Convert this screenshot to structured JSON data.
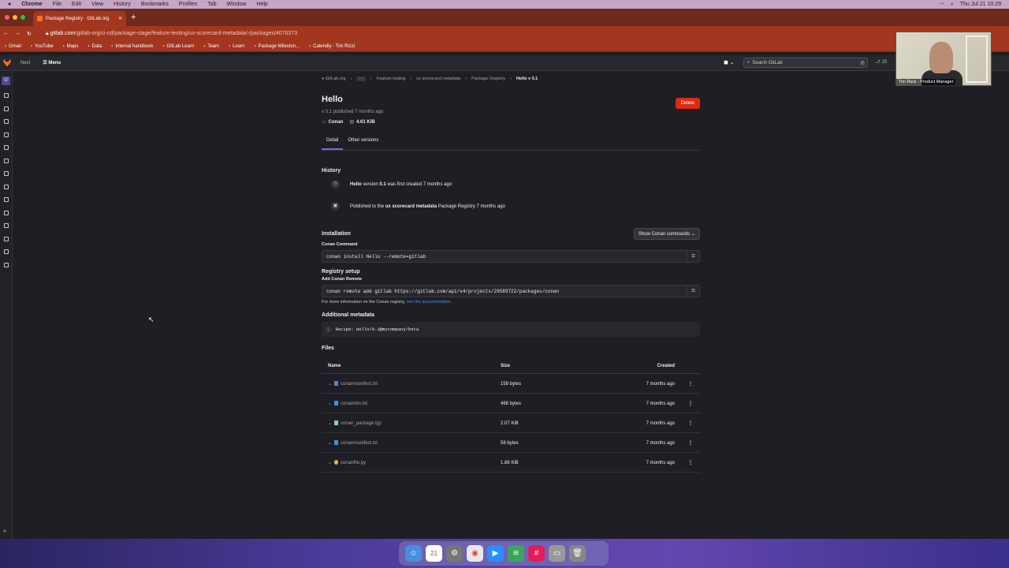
{
  "mac_menu": {
    "apple": "",
    "items": [
      "Chrome",
      "File",
      "Edit",
      "View",
      "History",
      "Bookmarks",
      "Profiles",
      "Tab",
      "Window",
      "Help"
    ],
    "datetime": "Thu Jul 21  10:29"
  },
  "browser": {
    "tab_title": "Package Registry · GitLab.org",
    "tab_close": "✕",
    "new_tab": "+",
    "url_host": "gitlab.com",
    "url_path": "/gitlab-org/ci-cd/package-stage/feature-testing/ux-scorecard-metadata/-/packages/4076373",
    "bookmarks": [
      "Gmail",
      "YouTube",
      "Maps",
      "Data",
      "Internal handbook",
      "GitLab Learn",
      "Team",
      "Learn",
      "Package Mileston...",
      "Calendly - Tim Rizzi"
    ]
  },
  "gitlab_top": {
    "next_label": "Next",
    "menu_label": "Menu",
    "search_placeholder": "Search GitLab",
    "search_shortcut": "/",
    "mr_count": "20"
  },
  "sidebar": {
    "avatar_letter": "U",
    "collapse": "»"
  },
  "breadcrumbs": [
    "GitLab.org",
    "···",
    "Feature testing",
    "ux scorecard metadata",
    "Package Registry",
    "Hello v 0.1"
  ],
  "package": {
    "title": "Hello",
    "delete_label": "Delete",
    "published": "v 0.1 published  7 months ago",
    "type": "Conan",
    "size": "4.61 KiB"
  },
  "tabs": [
    "Detail",
    "Other versions"
  ],
  "history": {
    "heading": "History",
    "row1_name": "Hello",
    "row1_mid": " version ",
    "row1_version": "0.1",
    "row1_end": " was first created 7 months ago",
    "row2_start": "Published to the ",
    "row2_project": "ux scorecard metadata",
    "row2_end": " Package Registry 7 months ago"
  },
  "installation": {
    "heading": "Installation",
    "show_commands": "Show Conan commands",
    "conan_command_label": "Conan Command",
    "conan_command": "conan install Hello --remote=gitlab",
    "registry_heading": "Registry setup",
    "add_remote_label": "Add Conan Remote",
    "add_remote_cmd": "conan remote add gitlab https://gitlab.com/api/v4/projects/29589722/packages/conan",
    "more_info": "For more information on the Conan registry, ",
    "doc_link": "see the documentation",
    "period": "."
  },
  "metadata": {
    "heading": "Additional metadata",
    "recipe": "Recipe: Hello/0.1@mycompany/beta"
  },
  "files": {
    "heading": "Files",
    "columns": [
      "Name",
      "Size",
      "Created"
    ],
    "rows": [
      {
        "name": "conanmanifest.txt",
        "size": "158 bytes",
        "created": "7 months ago",
        "icon": "file-icon"
      },
      {
        "name": "conaninfo.txt",
        "size": "468 bytes",
        "created": "7 months ago",
        "icon": "file-icon"
      },
      {
        "name": "conan_package.tgz",
        "size": "2.07 KiB",
        "created": "7 months ago",
        "icon": "archive-icon"
      },
      {
        "name": "conanmanifest.txt",
        "size": "58 bytes",
        "created": "7 months ago",
        "icon": "file-icon"
      },
      {
        "name": "conanfile.py",
        "size": "1.86 KiB",
        "created": "7 months ago",
        "icon": "python-icon"
      }
    ]
  },
  "webcam": {
    "label": "Tim Rizzi - Product Manager"
  },
  "colors": {
    "chrome_tab": "#a3361f",
    "delete": "#dd2b0e",
    "link": "#428fdc",
    "active_tab": "#6f6cd4"
  }
}
